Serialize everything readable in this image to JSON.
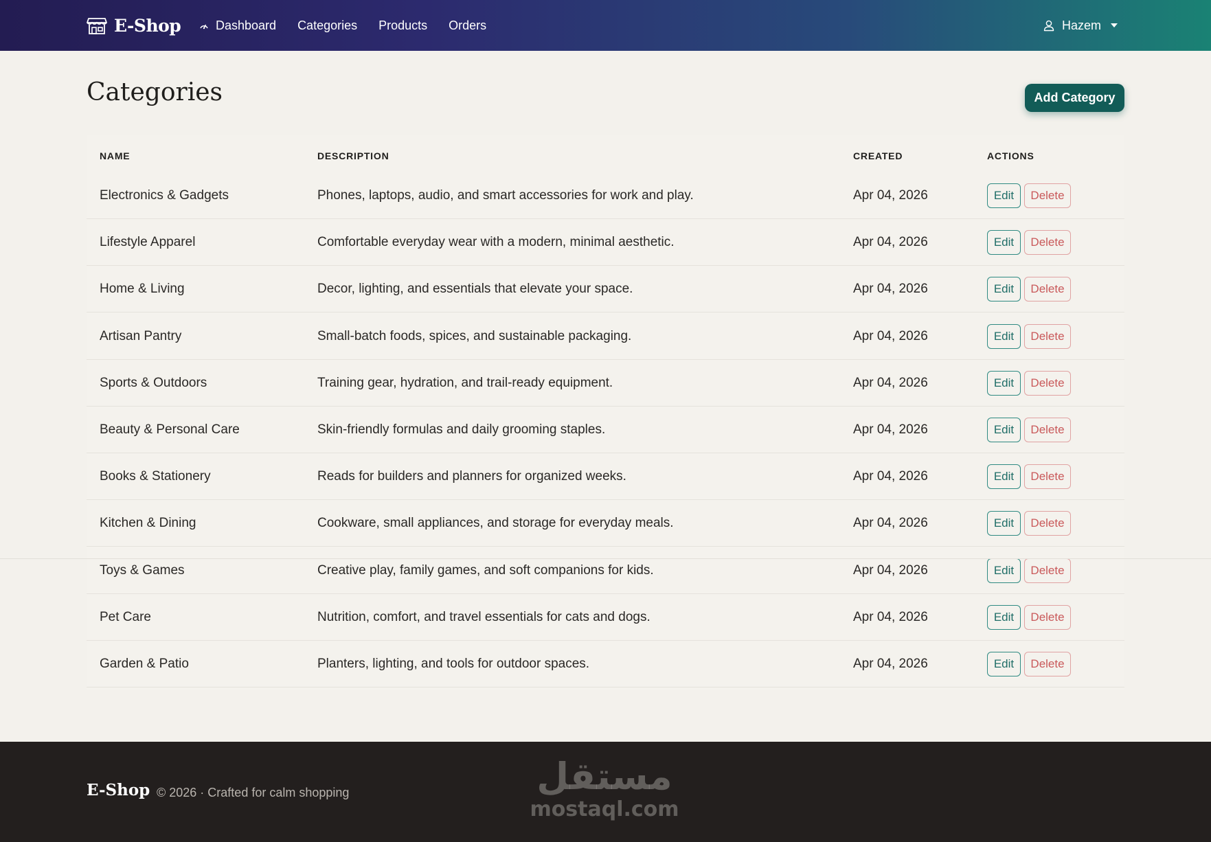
{
  "navbar": {
    "brand": "E-Shop",
    "links": [
      {
        "label": "Dashboard"
      },
      {
        "label": "Categories"
      },
      {
        "label": "Products"
      },
      {
        "label": "Orders"
      }
    ],
    "user": "Hazem"
  },
  "page": {
    "title": "Categories",
    "add_button": "Add Category"
  },
  "table": {
    "headers": [
      "NAME",
      "DESCRIPTION",
      "CREATED",
      "ACTIONS"
    ],
    "edit_label": "Edit",
    "delete_label": "Delete",
    "rows": [
      {
        "name": "Electronics & Gadgets",
        "description": "Phones, laptops, audio, and smart accessories for work and play.",
        "created": "Apr 04, 2026"
      },
      {
        "name": "Lifestyle Apparel",
        "description": "Comfortable everyday wear with a modern, minimal aesthetic.",
        "created": "Apr 04, 2026"
      },
      {
        "name": "Home & Living",
        "description": "Decor, lighting, and essentials that elevate your space.",
        "created": "Apr 04, 2026"
      },
      {
        "name": "Artisan Pantry",
        "description": "Small-batch foods, spices, and sustainable packaging.",
        "created": "Apr 04, 2026"
      },
      {
        "name": "Sports & Outdoors",
        "description": "Training gear, hydration, and trail-ready equipment.",
        "created": "Apr 04, 2026"
      },
      {
        "name": "Beauty & Personal Care",
        "description": "Skin-friendly formulas and daily grooming staples.",
        "created": "Apr 04, 2026"
      },
      {
        "name": "Books & Stationery",
        "description": "Reads for builders and planners for organized weeks.",
        "created": "Apr 04, 2026"
      },
      {
        "name": "Kitchen & Dining",
        "description": "Cookware, small appliances, and storage for everyday meals.",
        "created": "Apr 04, 2026"
      },
      {
        "name": "Toys & Games",
        "description": "Creative play, family games, and soft companions for kids.",
        "created": "Apr 04, 2026"
      },
      {
        "name": "Pet Care",
        "description": "Nutrition, comfort, and travel essentials for cats and dogs.",
        "created": "Apr 04, 2026"
      },
      {
        "name": "Garden & Patio",
        "description": "Planters, lighting, and tools for outdoor spaces.",
        "created": "Apr 04, 2026"
      }
    ]
  },
  "footer": {
    "brand": "E-Shop",
    "copy": "© 2026  · Crafted for calm shopping",
    "watermark_ar": "مستقل",
    "watermark_en": "mostaql.com"
  },
  "colors": {
    "nav_gradient_start": "#231c52",
    "nav_gradient_end": "#1a8274",
    "primary": "#125c57",
    "danger": "#c9595a",
    "footer_bg": "#231f1e",
    "page_bg": "#f3f1ec"
  },
  "icons": {
    "brand": "storefront-icon",
    "dashboard": "speedometer-icon",
    "user": "person-icon",
    "dropdown": "caret-down-icon"
  }
}
